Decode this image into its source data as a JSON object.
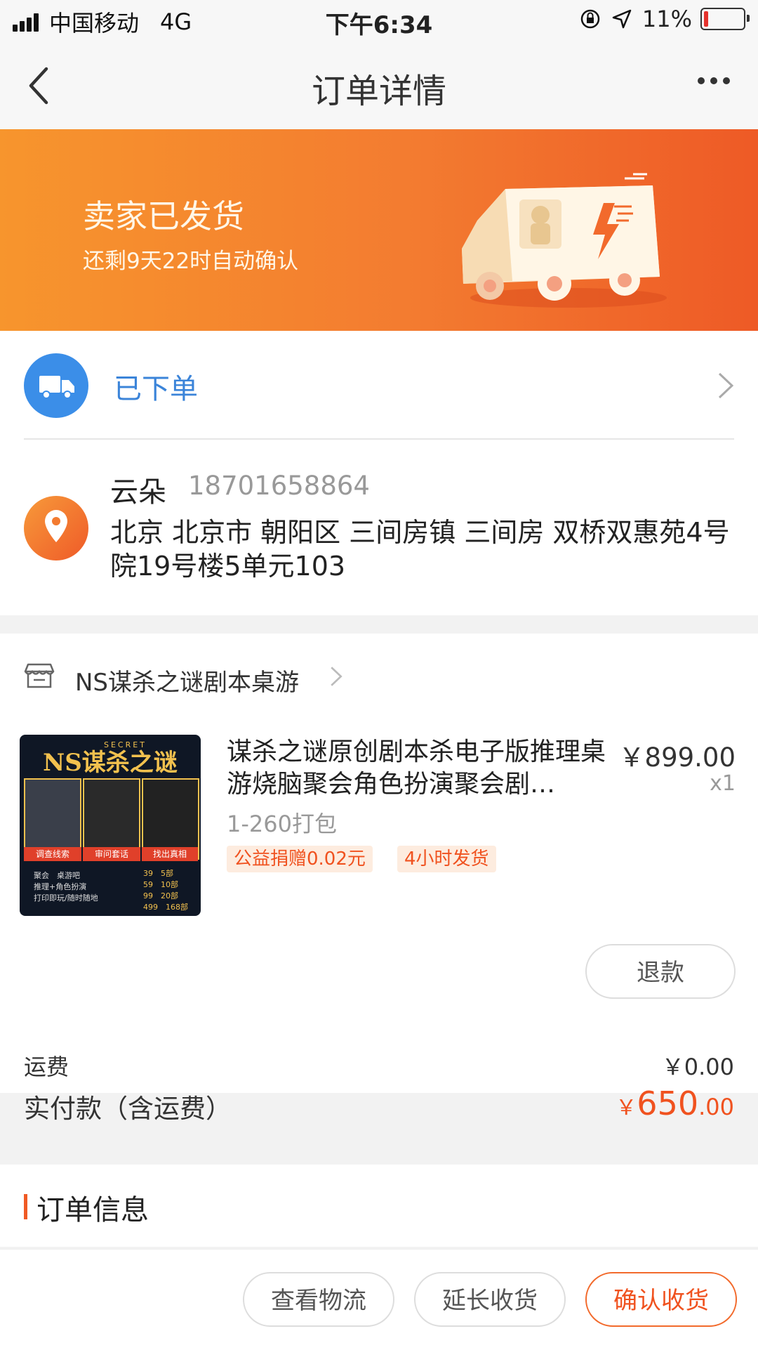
{
  "status_bar": {
    "carrier": "中国移动",
    "network": "4G",
    "time": "下午6:34",
    "battery": "11%",
    "battery_level": 0.11
  },
  "nav": {
    "title": "订单详情"
  },
  "banner": {
    "title": "卖家已发货",
    "subtitle": "还剩9天22时自动确认"
  },
  "shipping_status": {
    "label": "已下单"
  },
  "address": {
    "name": "云朵",
    "phone": "18701658864",
    "line": "北京 北京市 朝阳区 三间房镇 三间房 双桥双惠苑4号院19号楼5单元103"
  },
  "shop": {
    "name": "NS谋杀之谜剧本桌游"
  },
  "item": {
    "title": "谋杀之谜原创剧本杀电子版推理桌游烧脑聚会角色扮演聚会剧…",
    "price": "￥899.00",
    "qty": "x1",
    "sku": "1-260打包",
    "tags": [
      "公益捐赠0.02元",
      "4小时发货"
    ],
    "image": {
      "brand": "NS谋杀之谜",
      "secret": "SECRET",
      "panels": [
        "调查线索",
        "审问套话",
        "找出真相"
      ],
      "features": [
        "聚会　桌游吧",
        "推理+角色扮演",
        "打印即玩/随时随地"
      ],
      "prices": [
        "39　5部",
        "59　10部",
        "99　20部",
        "499　168部"
      ]
    }
  },
  "refund_button": "退款",
  "fees": {
    "shipping_label": "运费",
    "shipping_value": "￥0.00",
    "paid_label": "实付款（含运费）",
    "paid_currency": "￥",
    "paid_int": "650",
    "paid_dec": ".00"
  },
  "order_info": {
    "title": "订单信息"
  },
  "actions": {
    "view_logistics": "查看物流",
    "extend_receipt": "延长收货",
    "confirm_receipt": "确认收货"
  },
  "colors": {
    "accent": "#f0521f",
    "blue": "#3b84d9",
    "banner_start": "#f7952d",
    "banner_end": "#ee5a26"
  }
}
